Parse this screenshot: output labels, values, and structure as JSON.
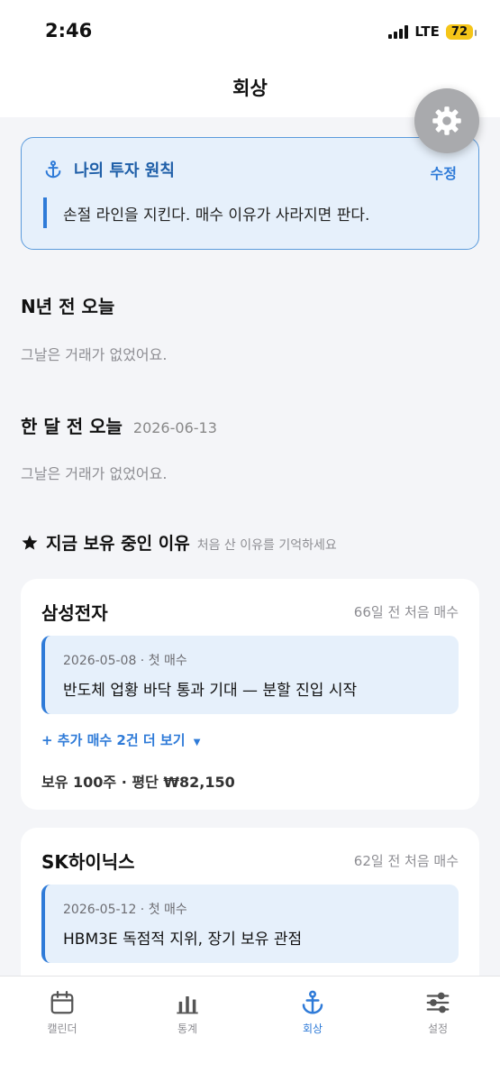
{
  "status": {
    "time": "2:46",
    "network": "LTE",
    "battery": "72"
  },
  "header": {
    "title": "회상"
  },
  "principle": {
    "title": "나의 투자 원칙",
    "edit_label": "수정",
    "text": "손절 라인을 지킨다. 매수 이유가 사라지면 판다."
  },
  "years_ago": {
    "title": "N년 전 오늘",
    "empty": "그날은 거래가 없었어요."
  },
  "month_ago": {
    "title": "한 달 전 오늘",
    "date": "2026-06-13",
    "empty": "그날은 거래가 없었어요."
  },
  "holding_reasons": {
    "title": "지금 보유 중인 이유",
    "subtitle": "처음 산 이유를 기억하세요",
    "stocks": [
      {
        "name": "삼성전자",
        "since": "66일 전 처음 매수",
        "trade_meta": "2026-05-08 · 첫 매수",
        "trade_reason": "반도체 업황 바닥 통과 기대 — 분할 진입 시작",
        "more_label": "+ 추가 매수 2건 더 보기",
        "holding": "보유 100주 · 평단 ₩82,150"
      },
      {
        "name": "SK하이닉스",
        "since": "62일 전 처음 매수",
        "trade_meta": "2026-05-12 · 첫 매수",
        "trade_reason": "HBM3E 독점적 지위, 장기 보유 관점"
      }
    ]
  },
  "tabs": [
    {
      "label": "캘린더",
      "icon": "calendar-icon"
    },
    {
      "label": "통계",
      "icon": "bar-chart-icon"
    },
    {
      "label": "회상",
      "icon": "anchor-icon",
      "active": true
    },
    {
      "label": "설정",
      "icon": "sliders-icon"
    }
  ],
  "colors": {
    "accent": "#2f7bd8",
    "card_blue": "#e6f0fb",
    "background": "#f4f5f8"
  }
}
